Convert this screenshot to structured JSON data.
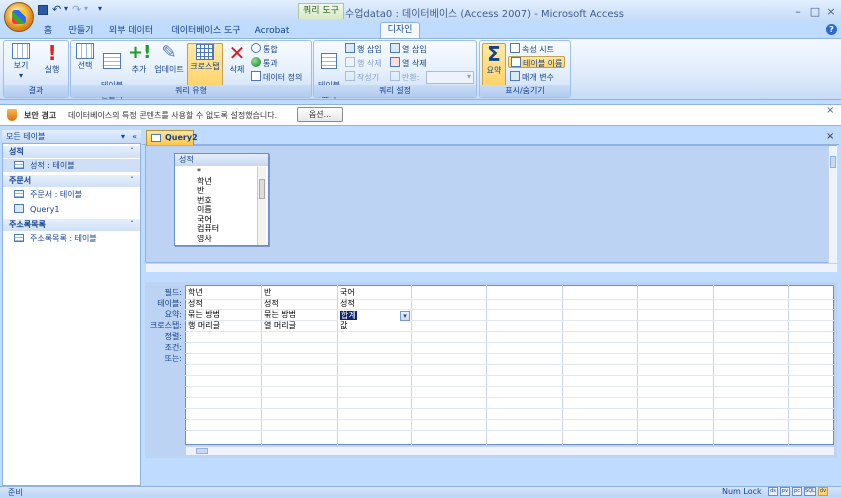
{
  "window": {
    "title": "수업data0 : 데이터베이스 (Access 2007) - Microsoft Access",
    "context_tab": "쿼리 도구",
    "min": "–",
    "max": "□",
    "close": "×",
    "help": "?"
  },
  "qat": {
    "dropdown": "▾"
  },
  "tabs": [
    "홈",
    "만들기",
    "외부 데이터",
    "데이터베이스 도구",
    "Acrobat",
    "디자인"
  ],
  "ribbon": {
    "groups": {
      "results": "결과",
      "query_type": "쿼리 유형",
      "query_setup": "쿼리 설정",
      "show_hide": "표시/숨기기"
    },
    "view": "보기",
    "view_arrow": "▾",
    "run": "실행",
    "select": "선택",
    "make_table": "테이블\n만들기",
    "append": "추가",
    "update": "업데이트",
    "crosstab": "크로스탭",
    "delete": "삭제",
    "union": "통합",
    "pass_through": "통과",
    "data_definition": "데이터 정의",
    "show_table": "테이블\n표시",
    "insert_rows": "행 삽입",
    "delete_rows": "행 삭제",
    "builder": "작성기",
    "insert_columns": "열 삽입",
    "delete_columns": "열 삭제",
    "return": "반환:",
    "totals": "요약",
    "property_sheet": "속성 시트",
    "table_names": "테이블 이름",
    "parameters": "매개 변수"
  },
  "security": {
    "title": "보안 경고",
    "message": "데이터베이스의 특정 콘텐츠를 사용할 수 없도록 설정했습니다.",
    "options": "옵션...",
    "close": "×"
  },
  "nav": {
    "header": "모든 테이블",
    "header_arrow": "▾",
    "header_collapse": "«",
    "chevron": "ˆ",
    "sections": [
      {
        "name": "성적",
        "items": [
          {
            "label": "성적 : 테이블",
            "type": "table"
          }
        ]
      },
      {
        "name": "주문서",
        "items": [
          {
            "label": "주문서 : 테이블",
            "type": "table"
          },
          {
            "label": "Query1",
            "type": "query"
          }
        ]
      },
      {
        "name": "주소록목록",
        "items": [
          {
            "label": "주소록목록 : 테이블",
            "type": "table"
          }
        ]
      }
    ]
  },
  "document": {
    "tab": "Query2",
    "close": "×",
    "table_box": {
      "name": "성적",
      "fields": [
        "*",
        "학년",
        "반",
        "번호",
        "이름",
        "국어",
        "컴퓨터",
        "영사"
      ]
    },
    "grid": {
      "row_labels": [
        "필드:",
        "테이블:",
        "요약:",
        "크로스탭:",
        "정렬:",
        "조건:",
        "또는:"
      ],
      "columns": [
        {
          "field": "학년",
          "table": "성적",
          "total": "묶는 방법",
          "crosstab": "행 머리글"
        },
        {
          "field": "반",
          "table": "성적",
          "total": "묶는 방법",
          "crosstab": "열 머리글"
        },
        {
          "field": "국어",
          "table": "성적",
          "total": "합계",
          "crosstab": "값"
        }
      ],
      "dropdown_arrow": "▾"
    }
  },
  "status": {
    "left": "준비",
    "right": "Num Lock",
    "views": [
      "ds",
      "pv",
      "pc",
      "SQL",
      "dv"
    ]
  }
}
